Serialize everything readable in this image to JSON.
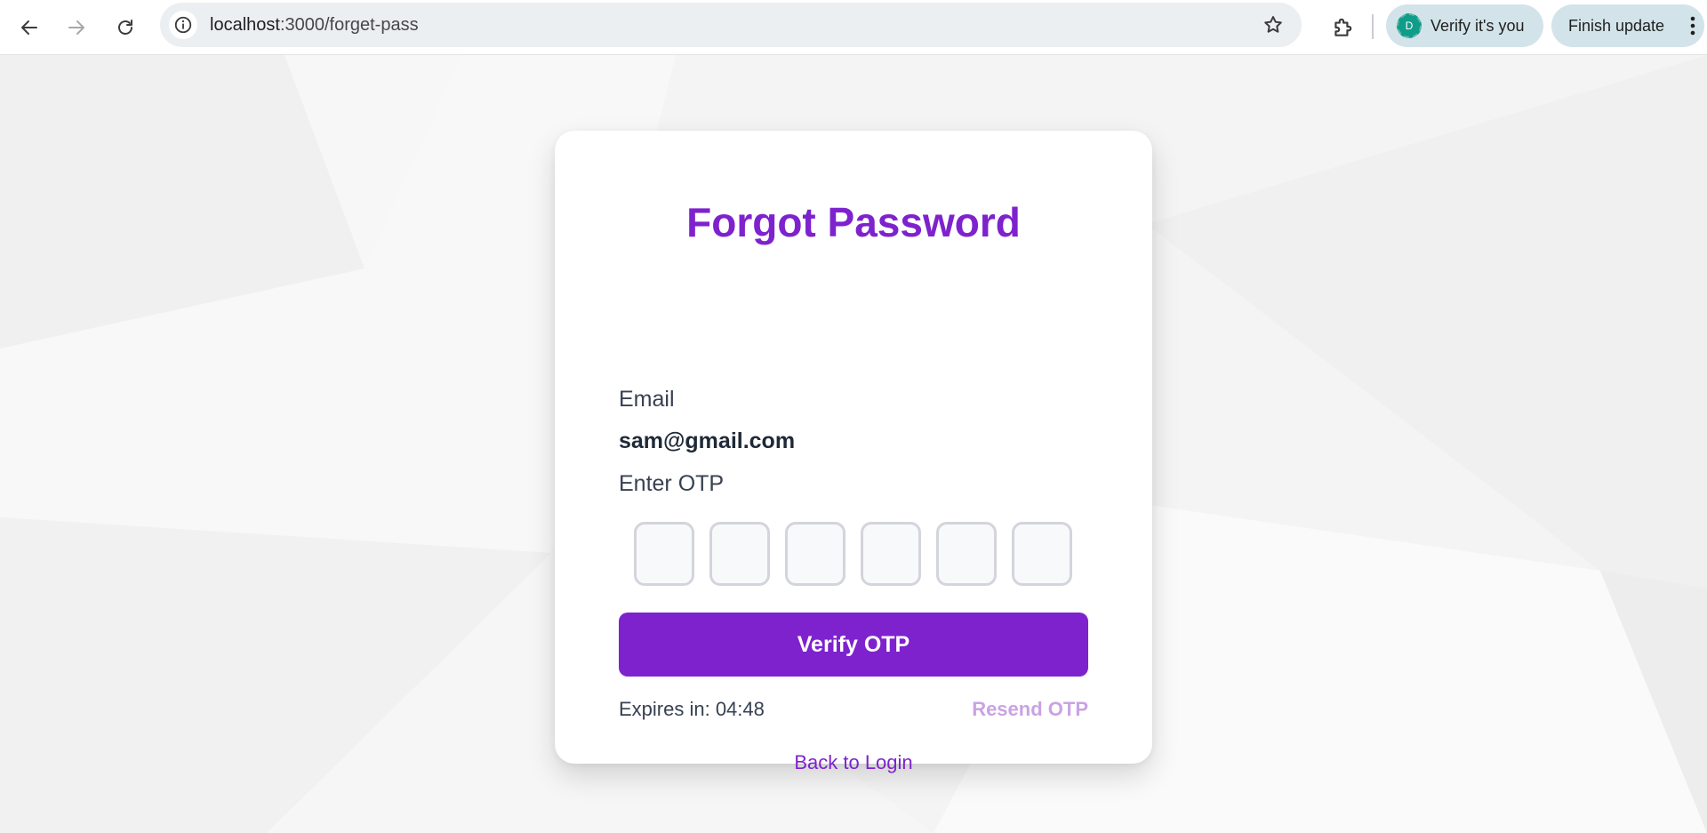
{
  "browser": {
    "url_host": "localhost",
    "url_path": ":3000/forget-pass",
    "profile_initial": "D",
    "verify_label": "Verify it's you",
    "update_label": "Finish update",
    "icons": [
      "back-icon",
      "forward-icon",
      "reload-icon",
      "info-icon",
      "star-icon",
      "extensions-icon",
      "kebab-menu-icon"
    ]
  },
  "form": {
    "title": "Forgot Password",
    "email_label": "Email",
    "email_value": "sam@gmail.com",
    "otp_label": "Enter OTP",
    "otp_digits": [
      "",
      "",
      "",
      "",
      "",
      ""
    ],
    "verify_button": "Verify OTP",
    "expires_text": "Expires in: 04:48",
    "resend_label": "Resend OTP",
    "back_label": "Back to Login"
  },
  "colors": {
    "accent": "#7e22ce",
    "resend_disabled": "#c9a3e3",
    "chip_bg": "#d3e3ea"
  }
}
